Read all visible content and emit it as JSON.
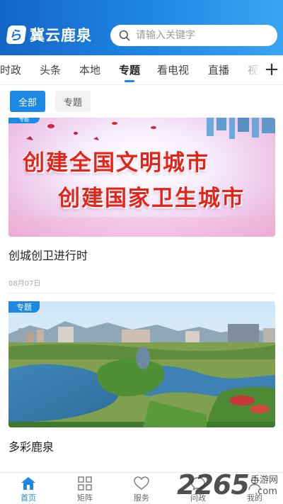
{
  "header": {
    "app_name": "冀云鹿泉",
    "search_placeholder": "请输入关键字"
  },
  "tabs": [
    {
      "label": "时政",
      "active": false
    },
    {
      "label": "头条",
      "active": false
    },
    {
      "label": "本地",
      "active": false
    },
    {
      "label": "专题",
      "active": true
    },
    {
      "label": "看电视",
      "active": false
    },
    {
      "label": "直播",
      "active": false
    },
    {
      "label": "视",
      "active": false
    }
  ],
  "filters": {
    "all": "全部",
    "topic": "专题"
  },
  "cards": [
    {
      "badge": "专题",
      "banner_line1": "创建全国文明城市",
      "banner_line2": "创建国家卫生城市",
      "title": "创城创卫进行时",
      "date": "08月07日"
    },
    {
      "badge": "专题",
      "title": "多彩鹿泉"
    }
  ],
  "bottom_nav": [
    {
      "label": "首页",
      "icon": "home-icon",
      "active": true
    },
    {
      "label": "矩阵",
      "icon": "grid-icon",
      "active": false
    },
    {
      "label": "服务",
      "icon": "heart-icon",
      "active": false
    },
    {
      "label": "问政",
      "icon": "chat-icon",
      "active": false
    },
    {
      "label": "我的",
      "icon": "user-icon",
      "active": false
    }
  ],
  "watermark": {
    "brand": "2265",
    "sub1": "手游网",
    "sub2": ".com"
  },
  "colors": {
    "primary": "#1e88e5",
    "banner_text": "#e3241d"
  }
}
